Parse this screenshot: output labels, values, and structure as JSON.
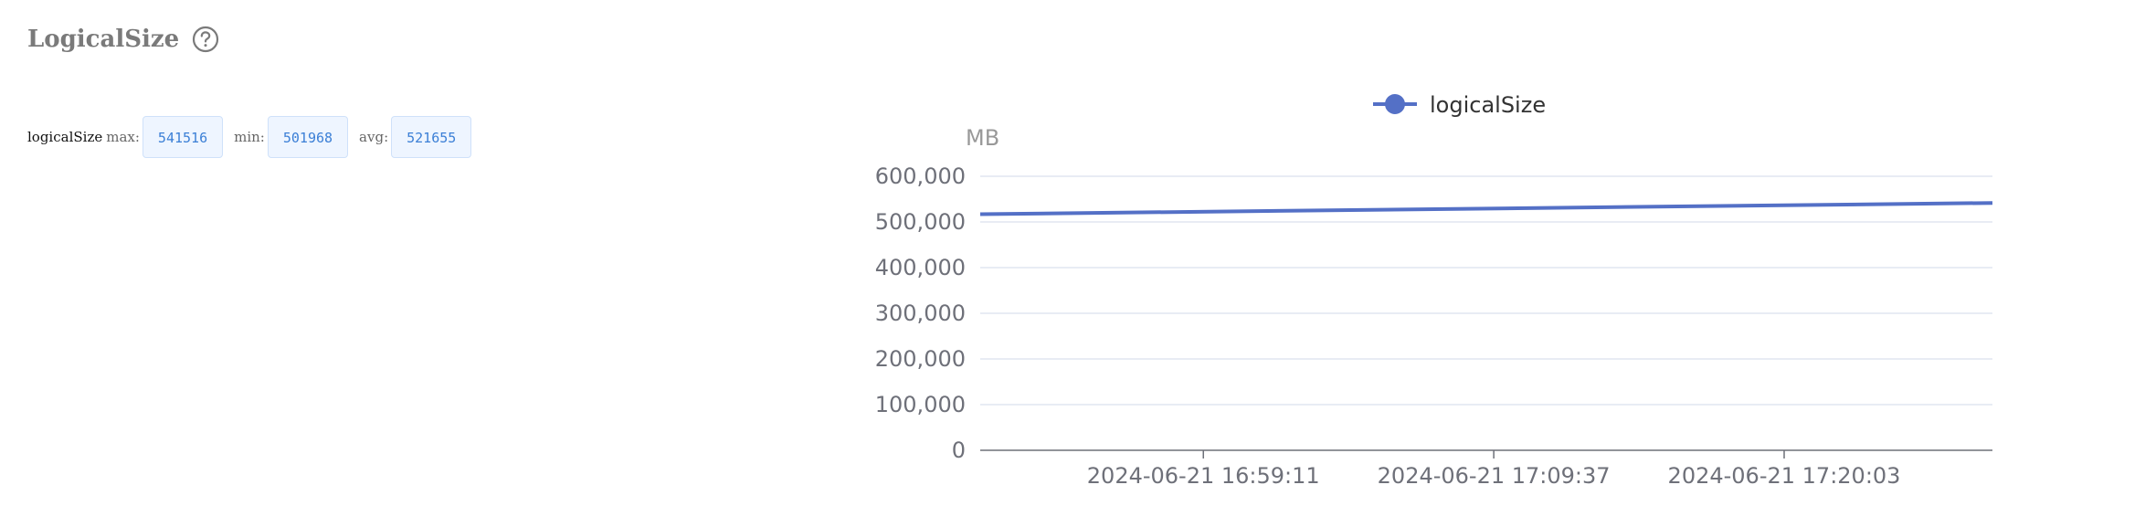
{
  "panel": {
    "title": "LogicalSize",
    "help_icon": "question-circle-icon"
  },
  "stats": {
    "series_name": "logicalSize",
    "max_label": "max:",
    "max_value": "541516",
    "min_label": "min:",
    "min_value": "501968",
    "avg_label": "avg:",
    "avg_value": "521655"
  },
  "colors": {
    "series": "#5470c6",
    "grid": "#e0e6f1",
    "axis": "#6e7079",
    "stat_value": "#3b7fd6"
  },
  "chart_data": {
    "type": "line",
    "legend": [
      "logicalSize"
    ],
    "legend_position": "top-center",
    "ylabel": "MB",
    "ylim": [
      0,
      600000
    ],
    "y_ticks": [
      0,
      100000,
      200000,
      300000,
      400000,
      500000,
      600000
    ],
    "y_tick_labels": [
      "0",
      "100,000",
      "200,000",
      "300,000",
      "400,000",
      "500,000",
      "600,000"
    ],
    "x_tick_labels": [
      "2024-06-21 16:59:11",
      "2024-06-21 17:09:37",
      "2024-06-21 17:20:03"
    ],
    "x_range": [
      "2024-06-21 16:51:10",
      "2024-06-21 17:27:32"
    ],
    "grid": true,
    "series": [
      {
        "name": "logicalSize",
        "x": [
          "2024-06-21 16:51:10",
          "2024-06-21 17:27:32"
        ],
        "values": [
          517000,
          541516
        ]
      }
    ]
  }
}
